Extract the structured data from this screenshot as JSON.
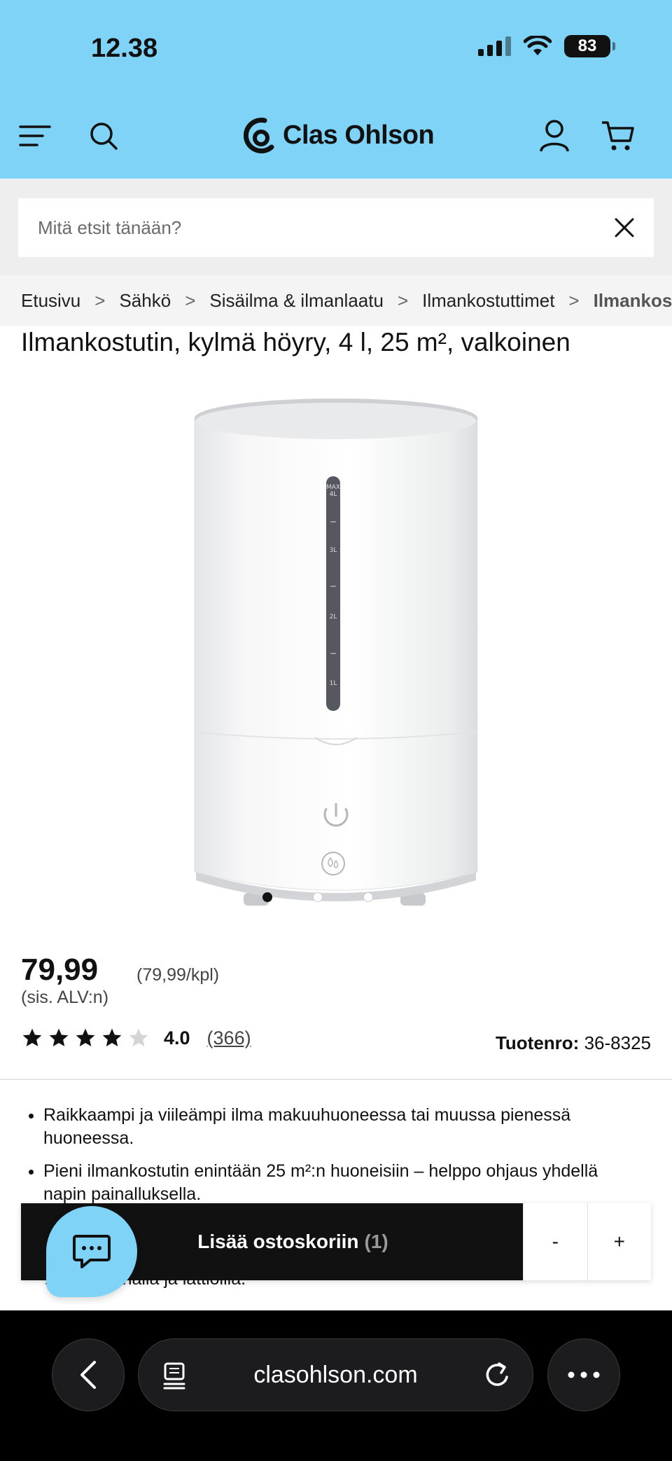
{
  "status_bar": {
    "time": "12.38",
    "battery": "83"
  },
  "header": {
    "logo_text": "Clas Ohlson",
    "icons": [
      "menu-icon",
      "search-icon",
      "account-icon",
      "cart-icon"
    ]
  },
  "search": {
    "placeholder": "Mitä etsit tänään?",
    "value": ""
  },
  "breadcrumb": [
    {
      "label": "Etusivu"
    },
    {
      "label": "Sähkö"
    },
    {
      "label": "Sisäilma & ilmanlaatu"
    },
    {
      "label": "Ilmankostuttimet"
    },
    {
      "label": "Ilmankostuttimet"
    }
  ],
  "product": {
    "title": "Ilmankostutin, kylmä höyry, 4 l, 25 m², valkoinen",
    "price": "79,99",
    "unit_price": "(79,99/kpl)",
    "vat_note": "(sis. ALV:n)",
    "rating_value": "4.0",
    "rating_count": "(366)",
    "rating_stars": 4,
    "rating_max": 5,
    "product_number_label": "Tuotenro:",
    "product_number": "36-8325",
    "image_count": 3,
    "active_image": 1,
    "bullets": [
      "Raikkaampi ja viileämpi ilma makuuhuoneessa tai muussa pienessä huoneessa.",
      "Pieni ilmankostutin enintään 25 m²:n huoneisiin – helppo ohjaus yhdellä napin painalluksella."
    ],
    "partial_text": "…ujen pinnalla ja lattioilla."
  },
  "cart": {
    "add_label": "Lisää ostoskoriin",
    "quantity": "(1)",
    "minus": "-",
    "plus": "+"
  },
  "browser": {
    "url": "clasohlson.com"
  },
  "colors": {
    "header_bg": "#7fd3f7",
    "button_bg": "#111111"
  }
}
